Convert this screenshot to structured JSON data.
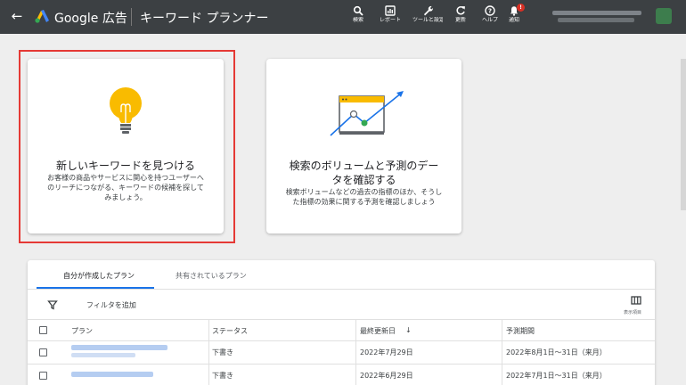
{
  "header": {
    "brand": "Google 広告",
    "tool_title": "キーワード プランナー",
    "actions": [
      {
        "label": "検索",
        "icon": "search-icon"
      },
      {
        "label": "レポート",
        "icon": "report-icon"
      },
      {
        "label": "ツールと設定",
        "icon": "wrench-icon"
      },
      {
        "label": "更新",
        "icon": "refresh-icon"
      },
      {
        "label": "ヘルプ",
        "icon": "help-icon"
      },
      {
        "label": "通知",
        "icon": "bell-icon",
        "badge": "!"
      }
    ]
  },
  "cards": {
    "discover": {
      "title": "新しいキーワードを見つける",
      "desc1": "お客様の商品やサービスに関心を持つユーザーへ",
      "desc2": "のリーチにつながる、キーワードの候補を探して",
      "desc3": "みましょう。"
    },
    "forecast": {
      "title1": "検索のボリュームと予測のデー",
      "title2": "タを確認する",
      "desc1": "検索ボリュームなどの過去の指標のほか、そうし",
      "desc2": "た指標の効果に関する予測を確認しましょう"
    }
  },
  "plans": {
    "tabs": [
      "自分が作成したプラン",
      "共有されているプラン"
    ],
    "filter_label": "フィルタを追加",
    "columns_label": "表示項目",
    "headers": {
      "plan": "プラン",
      "status": "ステータス",
      "updated": "最終更新日",
      "period": "予測期間"
    },
    "rows": [
      {
        "status": "下書き",
        "updated": "2022年7月29日",
        "period": "2022年8月1日～31日（来月）"
      },
      {
        "status": "下書き",
        "updated": "2022年6月29日",
        "period": "2022年7月1日～31日（来月）"
      }
    ]
  },
  "colors": {
    "topbar": "#3c4043",
    "accent": "#1a73e8",
    "highlight": "#e53935",
    "bulb": "#f9bb00"
  }
}
